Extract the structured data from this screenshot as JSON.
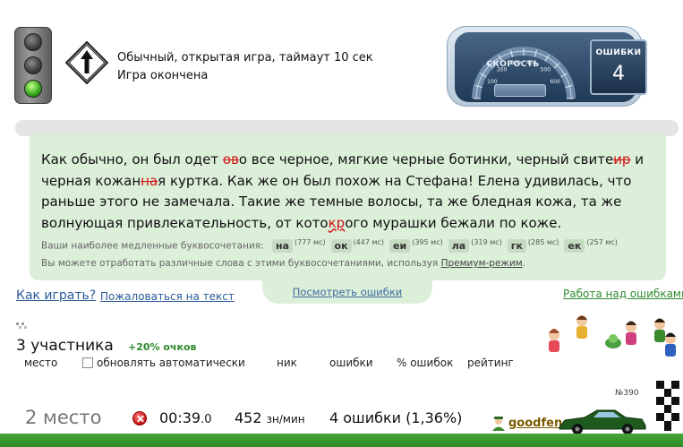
{
  "header": {
    "mode_line": "Обычный, открытая игра, таймаут 10 сек",
    "status_line": "Игра окончена"
  },
  "dashboard": {
    "speed_label": "СКОРОСТЬ",
    "speed_ticks": [
      "100",
      "200",
      "300",
      "400",
      "500",
      "600"
    ],
    "errors_label": "ОШИБКИ",
    "errors_count": "4"
  },
  "text": {
    "segments": [
      {
        "t": "Как обычно, он был одет "
      },
      {
        "t": "ов",
        "s": "err"
      },
      {
        "t": "о все черное, мягкие черные ботинки, черный свите"
      },
      {
        "t": "ир",
        "s": "err"
      },
      {
        "t": " и черная кожан"
      },
      {
        "t": "на",
        "s": "err"
      },
      {
        "t": "я куртка. Как же он был похож на Стефана! Елена удивилась, что раньше этого не замечала. Такие же темные волосы, та же бледная кожа, та же волнующая привлекательность, от кото"
      },
      {
        "t": "кр",
        "s": "errp"
      },
      {
        "t": "ого мурашки бежали по коже."
      }
    ]
  },
  "slow_combos": {
    "label": "Ваши наиболее медленные буквосочетания:",
    "items": [
      {
        "combo": "на",
        "ms": "(777 мс)"
      },
      {
        "combo": "ок",
        "ms": "(447 мс)"
      },
      {
        "combo": "еи",
        "ms": "(395 мс)"
      },
      {
        "combo": "ла",
        "ms": "(319 мс)"
      },
      {
        "combo": "гк",
        "ms": "(285 мс)"
      },
      {
        "combo": "ек",
        "ms": "(257 мс)"
      }
    ]
  },
  "practice": {
    "text": "Вы можете отработать различные слова с этими буквосочетаниями, используя",
    "link": "Премиум-режим",
    "suffix": "."
  },
  "links": {
    "how_to_play": "Как играть?",
    "complain": "Пожаловаться на текст",
    "view_errors": "Посмотреть ошибки",
    "work_on_errors": "Работа над ошибками"
  },
  "participants": {
    "count": "3 участника",
    "bonus": "+20% очков"
  },
  "table_header": {
    "place": "место",
    "auto_update": "обновлять автоматически",
    "nick": "ник",
    "errors": "ошибки",
    "error_pct": "% ошибок",
    "rating": "рейтинг"
  },
  "result": {
    "place": "2 место",
    "time_main": "00:39",
    "time_frac": ".0",
    "speed_value": "452",
    "speed_unit": "зн/мин",
    "errors": "4 ошибки (1,36%)",
    "car_number": "№390",
    "username": "goodfen"
  },
  "colors": {
    "panel_bg": "#dcefd9",
    "error_red": "#d01515",
    "link_blue": "#2a5a9a",
    "green": "#2e8a2e",
    "track_green": "#3a9a2e"
  }
}
